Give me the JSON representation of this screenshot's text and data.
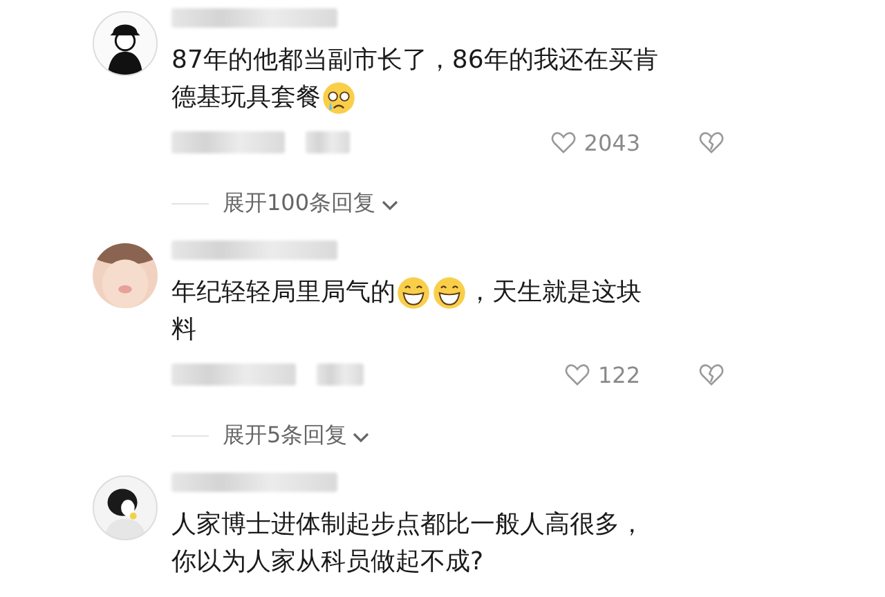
{
  "comments": [
    {
      "lines": [
        [
          {
            "kind": "text",
            "text": "87年的他都当副市长了，86年的我还在买肯"
          }
        ],
        [
          {
            "kind": "text",
            "text": "德基玩具套餐"
          },
          {
            "kind": "crying-emoji"
          }
        ]
      ],
      "likes": "2043",
      "replies": "展开100条回复"
    },
    {
      "lines": [
        [
          {
            "kind": "text",
            "text": "年纪轻轻局里局气的"
          },
          {
            "kind": "grin-emoji"
          },
          {
            "kind": "grin-emoji"
          },
          {
            "kind": "text",
            "text": "，天生就是这块"
          }
        ],
        [
          {
            "kind": "text",
            "text": "料"
          }
        ]
      ],
      "likes": "122",
      "replies": "展开5条回复"
    },
    {
      "lines": [
        [
          {
            "kind": "text",
            "text": "人家博士进体制起步点都比一般人高很多，"
          }
        ],
        [
          {
            "kind": "text",
            "text": "你以为人家从科员做起不成?"
          }
        ]
      ]
    }
  ]
}
